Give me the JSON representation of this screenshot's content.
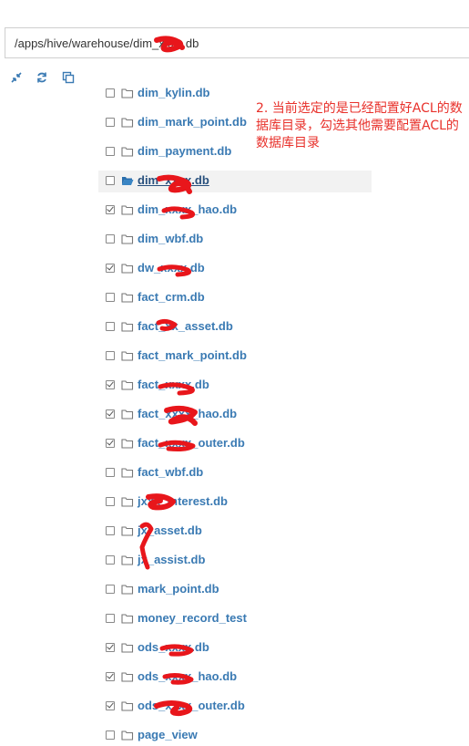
{
  "path_bar": {
    "value": "/apps/hive/warehouse/dim_xxxx.db"
  },
  "toolbar": [
    {
      "name": "collapse-icon"
    },
    {
      "name": "refresh-icon"
    },
    {
      "name": "copy-icon"
    }
  ],
  "annotation": "2. 当前选定的是已经配置好ACL的数据库目录，勾选其他需要配置ACL的数据库目录",
  "colors": {
    "link": "#3a7ab3",
    "annotation": "#e8312b",
    "scribble": "#e8161b"
  },
  "tree": [
    {
      "label": "dim_kylin.db",
      "checked": false,
      "selected": false
    },
    {
      "label": "dim_mark_point.db",
      "checked": false,
      "selected": false
    },
    {
      "label": "dim_payment.db",
      "checked": false,
      "selected": false
    },
    {
      "label": "dim_xxxx.db",
      "checked": false,
      "selected": true
    },
    {
      "label": "dim_xxxx_hao.db",
      "checked": true,
      "selected": false
    },
    {
      "label": "dim_wbf.db",
      "checked": false,
      "selected": false
    },
    {
      "label": "dw_xxxx.db",
      "checked": true,
      "selected": false
    },
    {
      "label": "fact_crm.db",
      "checked": false,
      "selected": false
    },
    {
      "label": "fact_xx_asset.db",
      "checked": false,
      "selected": false
    },
    {
      "label": "fact_mark_point.db",
      "checked": false,
      "selected": false
    },
    {
      "label": "fact_xxxx.db",
      "checked": true,
      "selected": false
    },
    {
      "label": "fact_xxxx_hao.db",
      "checked": true,
      "selected": false
    },
    {
      "label": "fact_xxxx_outer.db",
      "checked": true,
      "selected": false
    },
    {
      "label": "fact_wbf.db",
      "checked": false,
      "selected": false
    },
    {
      "label": "jxxx_interest.db",
      "checked": false,
      "selected": false
    },
    {
      "label": "jx_asset.db",
      "checked": false,
      "selected": false
    },
    {
      "label": "jx_assist.db",
      "checked": false,
      "selected": false
    },
    {
      "label": "mark_point.db",
      "checked": false,
      "selected": false
    },
    {
      "label": "money_record_test",
      "checked": false,
      "selected": false
    },
    {
      "label": "ods_xxxx.db",
      "checked": true,
      "selected": false
    },
    {
      "label": "ods_xxxx_hao.db",
      "checked": true,
      "selected": false
    },
    {
      "label": "ods_xxxx_outer.db",
      "checked": true,
      "selected": false
    },
    {
      "label": "page_view",
      "checked": false,
      "selected": false
    }
  ]
}
